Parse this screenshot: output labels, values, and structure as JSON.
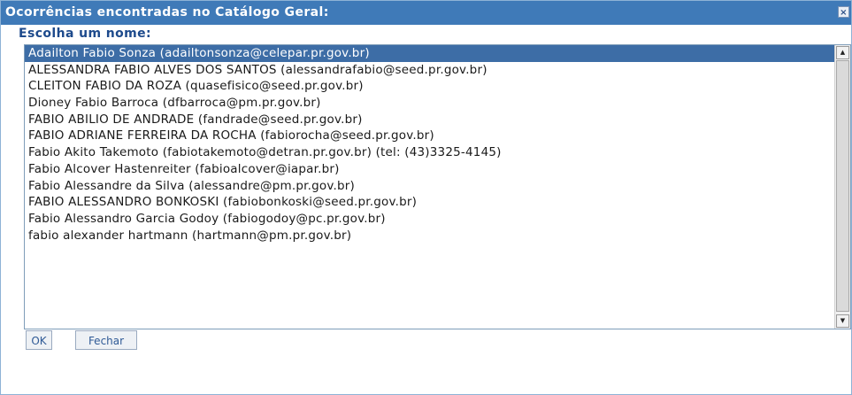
{
  "dialog": {
    "title": "Ocorrências encontradas no Catálogo Geral:",
    "close_glyph": "×",
    "prompt": "Escolha um nome:",
    "items": [
      "Adailton Fabio Sonza (adailtonsonza@celepar.pr.gov.br)",
      "ALESSANDRA FABIO ALVES DOS SANTOS (alessandrafabio@seed.pr.gov.br)",
      "CLEITON FABIO DA ROZA (quasefisico@seed.pr.gov.br)",
      "Dioney Fabio Barroca (dfbarroca@pm.pr.gov.br)",
      "FABIO ABILIO DE ANDRADE (fandrade@seed.pr.gov.br)",
      "FABIO ADRIANE FERREIRA DA ROCHA (fabiorocha@seed.pr.gov.br)",
      "Fabio Akito Takemoto (fabiotakemoto@detran.pr.gov.br) (tel: (43)3325-4145)",
      "Fabio Alcover Hastenreiter (fabioalcover@iapar.br)",
      "Fabio Alessandre da Silva (alessandre@pm.pr.gov.br)",
      "FABIO ALESSANDRO BONKOSKI (fabiobonkoski@seed.pr.gov.br)",
      "Fabio Alessandro Garcia Godoy (fabiogodoy@pc.pr.gov.br)",
      "fabio alexander hartmann (hartmann@pm.pr.gov.br)"
    ],
    "selected_index": 0,
    "ok_label": "OK",
    "close_label": "Fechar"
  },
  "colors": {
    "title_bar": "#3f7ab8",
    "selection": "#3d6da6",
    "prompt_text": "#1d4a8c"
  },
  "icons": {
    "close": "close-icon",
    "scroll_up": "arrow-up-icon",
    "scroll_down": "arrow-down-icon"
  }
}
